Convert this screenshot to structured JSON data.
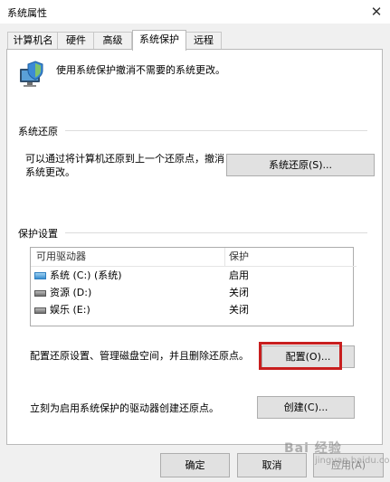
{
  "window": {
    "title": "系统属性",
    "close_glyph": "✕"
  },
  "tabs": [
    {
      "label": "计算机名"
    },
    {
      "label": "硬件"
    },
    {
      "label": "高级"
    },
    {
      "label": "系统保护",
      "active": true
    },
    {
      "label": "远程"
    }
  ],
  "intro": {
    "icon": "shield-computer-icon",
    "text": "使用系统保护撤消不需要的系统更改。"
  },
  "system_restore": {
    "group_title": "系统还原",
    "description": "可以通过将计算机还原到上一个还原点，撤消系统更改。",
    "button_label": "系统还原(S)..."
  },
  "protection_settings": {
    "group_title": "保护设置",
    "columns": [
      "可用驱动器",
      "保护"
    ],
    "drives": [
      {
        "name": "系统 (C:) (系统)",
        "protection": "启用",
        "icon": "system-drive-icon"
      },
      {
        "name": "资源 (D:)",
        "protection": "关闭",
        "icon": "drive-icon"
      },
      {
        "name": "娱乐 (E:)",
        "protection": "关闭",
        "icon": "drive-icon"
      }
    ],
    "configure_description": "配置还原设置、管理磁盘空间，并且删除还原点。",
    "configure_button": "配置(O)...",
    "create_description": "立刻为启用系统保护的驱动器创建还原点。",
    "create_button": "创建(C)..."
  },
  "footer": {
    "ok_button": "确定",
    "cancel_button": "取消",
    "apply_button": "应用(A)"
  },
  "watermark": {
    "text": "Bai 经验",
    "sub": "jingyan.baidu.com"
  },
  "colors": {
    "highlight_border": "#c81e1e",
    "window_bg": "#f0f0f0",
    "panel_bg": "#ffffff"
  }
}
